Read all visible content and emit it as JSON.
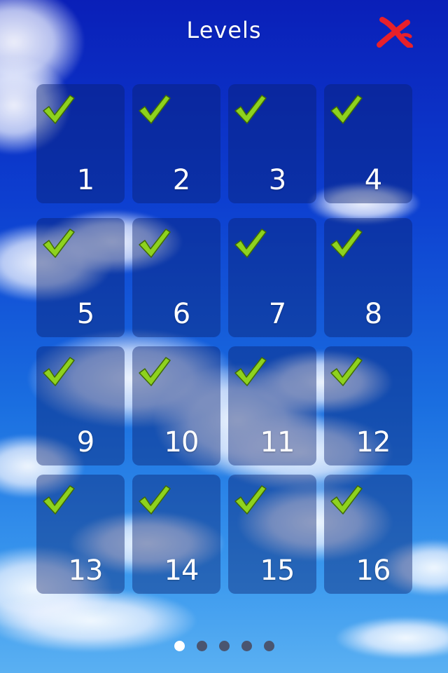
{
  "header": {
    "title": "Levels",
    "close_icon": "close-x-icon",
    "close_color": "#e8202a"
  },
  "levels": [
    {
      "number": "1",
      "completed": true
    },
    {
      "number": "2",
      "completed": true
    },
    {
      "number": "3",
      "completed": true
    },
    {
      "number": "4",
      "completed": true
    },
    {
      "number": "5",
      "completed": true
    },
    {
      "number": "6",
      "completed": true
    },
    {
      "number": "7",
      "completed": true
    },
    {
      "number": "8",
      "completed": true
    },
    {
      "number": "9",
      "completed": true
    },
    {
      "number": "10",
      "completed": true
    },
    {
      "number": "11",
      "completed": true
    },
    {
      "number": "12",
      "completed": true
    },
    {
      "number": "13",
      "completed": true
    },
    {
      "number": "14",
      "completed": true
    },
    {
      "number": "15",
      "completed": true
    },
    {
      "number": "16",
      "completed": true
    }
  ],
  "check_icon": "checkmark-icon",
  "check_color": "#8ed21e",
  "pager": {
    "pages": 5,
    "active_index": 0
  }
}
